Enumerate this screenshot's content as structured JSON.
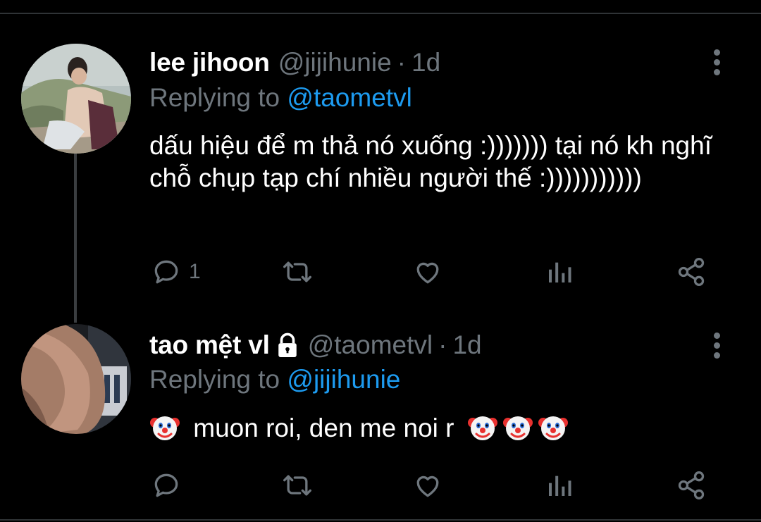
{
  "tweets": [
    {
      "name": "lee jihoon",
      "handle": "@jijihunie",
      "separator": "·",
      "time": "1d",
      "replying_prefix": "Replying to",
      "replying_to": "@taometvl",
      "text": "dấu hiệu để m thả nó xuống :))))))) tại nó kh nghĩ chỗ chụp tạp chí nhiều người thế :)))))))))))",
      "reply_count": "1",
      "locked": false
    },
    {
      "name": "tao mệt vl",
      "handle": "@taometvl",
      "separator": "·",
      "time": "1d",
      "replying_prefix": "Replying to",
      "replying_to": "@jijihunie",
      "text": "muon roi, den me noi r",
      "reply_count": "",
      "locked": true
    }
  ],
  "icons": [
    "reply-icon",
    "retweet-icon",
    "like-icon",
    "analytics-icon",
    "share-icon",
    "more-icon",
    "lock-icon",
    "clown-emoji"
  ],
  "colors": {
    "background": "#000000",
    "secondary": "#6e767d",
    "accent": "#1d9bf0",
    "divider": "#2f3336"
  }
}
